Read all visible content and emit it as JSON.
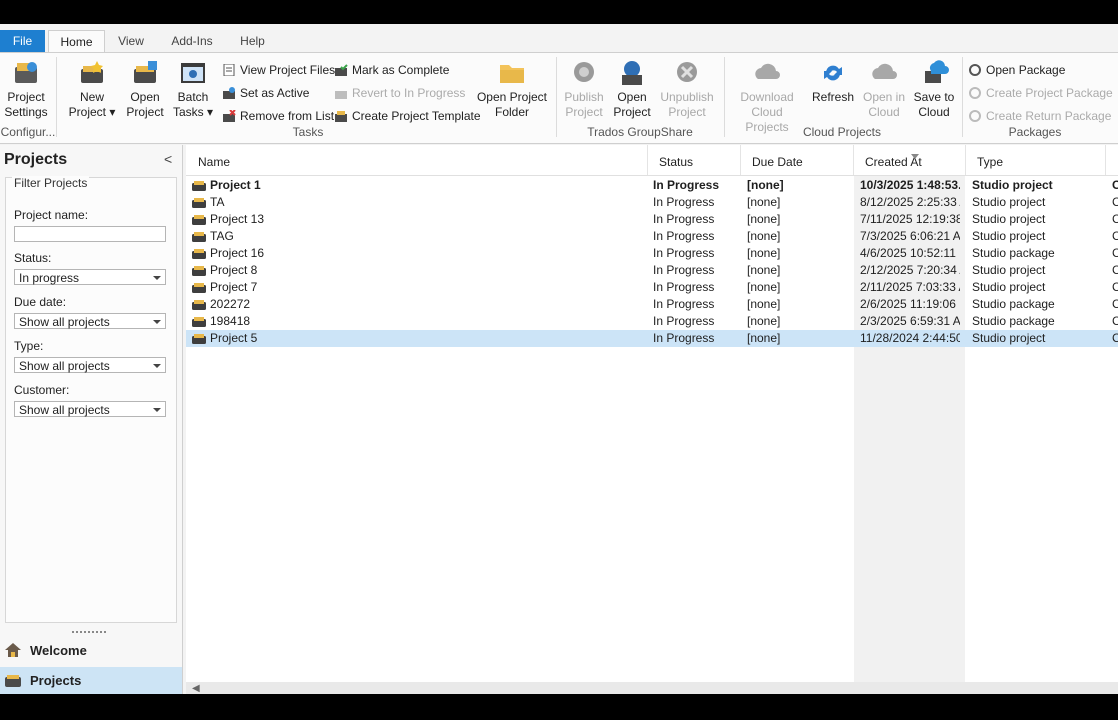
{
  "ribbon_tabs": [
    "File",
    "Home",
    "View",
    "Add-Ins",
    "Help"
  ],
  "ribbon": {
    "project_settings": [
      "Project",
      "Settings"
    ],
    "new_project": [
      "New",
      "Project ▾"
    ],
    "open_project": [
      "Open",
      "Project"
    ],
    "batch_tasks": [
      "Batch",
      "Tasks ▾"
    ],
    "view_project_files": "View Project Files",
    "set_as_active": "Set as Active",
    "remove_from_list": "Remove from List",
    "mark_as_complete": "Mark as Complete",
    "revert_to_in_progress": "Revert to In Progress",
    "create_project_template": "Create Project Template",
    "open_project_folder": [
      "Open Project",
      "Folder"
    ],
    "publish_project": [
      "Publish",
      "Project"
    ],
    "open_project_gs": [
      "Open",
      "Project"
    ],
    "unpublish_project": [
      "Unpublish",
      "Project"
    ],
    "download_cloud_projects": [
      "Download",
      "Cloud Projects"
    ],
    "refresh": "Refresh",
    "open_in_cloud": [
      "Open in",
      "Cloud"
    ],
    "save_to_cloud": [
      "Save to",
      "Cloud"
    ],
    "open_package": "Open Package",
    "create_project_package": "Create Project Package",
    "create_return_package": "Create Return Package",
    "groups": {
      "configure": "Configur...",
      "tasks": "Tasks",
      "groupshare": "Trados GroupShare",
      "cloud": "Cloud Projects",
      "packages": "Packages"
    }
  },
  "left_panel": {
    "title": "Projects",
    "collapse": "<",
    "filter_title": "Filter Projects",
    "project_name_label": "Project name:",
    "project_name_value": "",
    "status_label": "Status:",
    "status_value": "In progress",
    "due_label": "Due date:",
    "due_value": "Show all projects",
    "type_label": "Type:",
    "type_value": "Show all projects",
    "customer_label": "Customer:",
    "customer_value": "Show all projects",
    "nav_welcome": "Welcome",
    "nav_projects": "Projects"
  },
  "grid": {
    "columns": [
      "Name",
      "Status",
      "Due Date",
      "Created At",
      "Type"
    ],
    "rows": [
      {
        "name": "Project 1",
        "status": "In Progress",
        "due": "[none]",
        "created": "10/3/2025 1:48:53...",
        "type": "Studio project",
        "customer": "C"
      },
      {
        "name": "TA",
        "status": "In Progress",
        "due": "[none]",
        "created": "8/12/2025  2:25:33 A...",
        "type": "Studio project",
        "customer": "C"
      },
      {
        "name": "Project 13",
        "status": "In Progress",
        "due": "[none]",
        "created": "7/11/2025  12:19:38...",
        "type": "Studio project",
        "customer": "C"
      },
      {
        "name": "TAG",
        "status": "In Progress",
        "due": "[none]",
        "created": "7/3/2025 6:06:21 AM",
        "type": "Studio project",
        "customer": "C"
      },
      {
        "name": "Project 16",
        "status": "In Progress",
        "due": "[none]",
        "created": "4/6/2025  10:52:11 P...",
        "type": "Studio package",
        "customer": "C"
      },
      {
        "name": "Project 8",
        "status": "In Progress",
        "due": "[none]",
        "created": "2/12/2025  7:20:34 A...",
        "type": "Studio project",
        "customer": "C"
      },
      {
        "name": "Project 7",
        "status": "In Progress",
        "due": "[none]",
        "created": "2/11/2025  7:03:33 A...",
        "type": "Studio project",
        "customer": "C"
      },
      {
        "name": "202272",
        "status": "In Progress",
        "due": "[none]",
        "created": "2/6/2025  11:19:06 P...",
        "type": "Studio package",
        "customer": "C"
      },
      {
        "name": "198418",
        "status": "In Progress",
        "due": "[none]",
        "created": "2/3/2025 6:59:31 AM",
        "type": "Studio package",
        "customer": "C"
      },
      {
        "name": "Project 5",
        "status": "In Progress",
        "due": "[none]",
        "created": "11/28/2024  2:44:50...",
        "type": "Studio project",
        "customer": "C"
      }
    ]
  },
  "colors": {
    "accent": "#1e7fd0",
    "selected_row": "#cce4f7",
    "folder": "#e8b84a"
  }
}
